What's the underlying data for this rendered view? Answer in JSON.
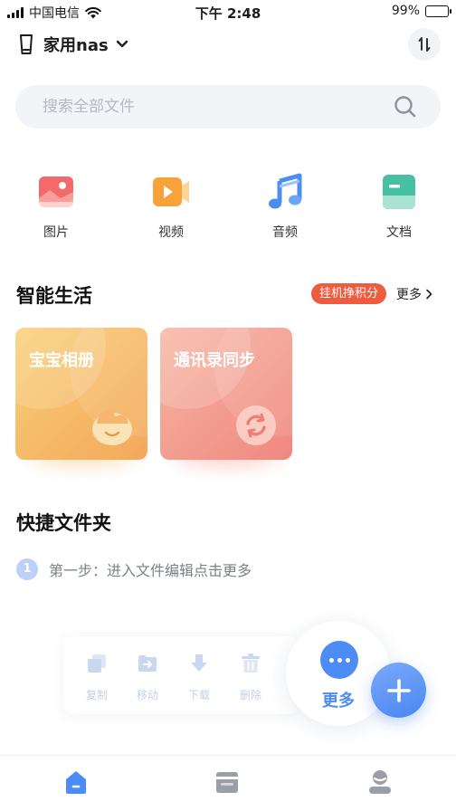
{
  "status_bar": {
    "carrier": "中国电信",
    "time": "下午 2:48",
    "battery_text": "99%",
    "battery_level": 0.99
  },
  "header": {
    "device_name": "家用nas",
    "icons": {
      "device": "nas-device-icon",
      "dropdown": "chevron-down-icon",
      "switch": "swap-arrows-icon"
    }
  },
  "search": {
    "placeholder": "搜索全部文件",
    "icon": "search-icon"
  },
  "categories": [
    {
      "label": "图片",
      "icon": "image-icon",
      "color": "#f46a6a"
    },
    {
      "label": "视频",
      "icon": "video-icon",
      "color": "#f7a33a"
    },
    {
      "label": "音频",
      "icon": "music-note-icon",
      "color": "#4a8ef0"
    },
    {
      "label": "文档",
      "icon": "document-icon",
      "color": "#46c0a3"
    }
  ],
  "smart_life": {
    "title": "智能生活",
    "promo_badge": "挂机挣积分",
    "more_label": "更多",
    "cards": [
      {
        "title": "宝宝相册",
        "icon": "baby-face-icon",
        "color_from": "#f9cf76",
        "color_to": "#f3a85c"
      },
      {
        "title": "通讯录同步",
        "icon": "sync-icon",
        "color_from": "#f7b6a2",
        "color_to": "#ef8780"
      }
    ]
  },
  "quick_folder": {
    "title": "快捷文件夹",
    "step_number": "1",
    "step_text": "第一步：进入文件编辑点击更多"
  },
  "toolbar": {
    "items": [
      {
        "label": "复制",
        "icon": "copy-icon"
      },
      {
        "label": "移动",
        "icon": "move-folder-icon"
      },
      {
        "label": "下载",
        "icon": "download-icon"
      },
      {
        "label": "删除",
        "icon": "trash-icon"
      }
    ],
    "more_label": "更多"
  },
  "bottom_nav": {
    "items": [
      {
        "icon": "home-icon",
        "active": true
      },
      {
        "icon": "files-icon",
        "active": false
      },
      {
        "icon": "profile-icon",
        "active": false
      }
    ],
    "active_color": "#4c8cf5",
    "inactive_color": "#9a9ea6"
  },
  "colors": {
    "accent": "#4c8cf5",
    "promo": "#ee5b3f"
  }
}
